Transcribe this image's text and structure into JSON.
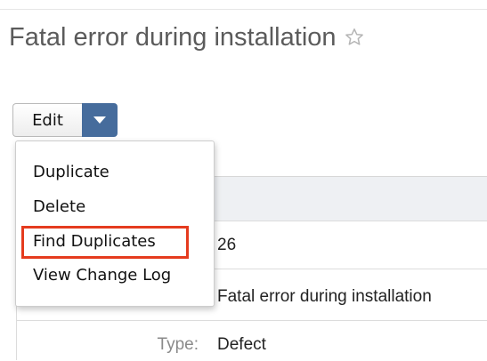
{
  "record": {
    "title": "Fatal error during installation",
    "favorite_icon": "star-outline-icon"
  },
  "actions": {
    "edit_label": "Edit",
    "caret_icon": "caret-down-icon",
    "menu": [
      "Duplicate",
      "Delete",
      "Find Duplicates",
      "View Change Log"
    ],
    "highlighted_item": "Find Duplicates",
    "highlight_color": "#e53b1e",
    "accent_color": "#466c9c"
  },
  "details": {
    "number_value": "26",
    "subject_value": "Fatal error during installation",
    "type_label": "Type:",
    "type_value": "Defect"
  }
}
